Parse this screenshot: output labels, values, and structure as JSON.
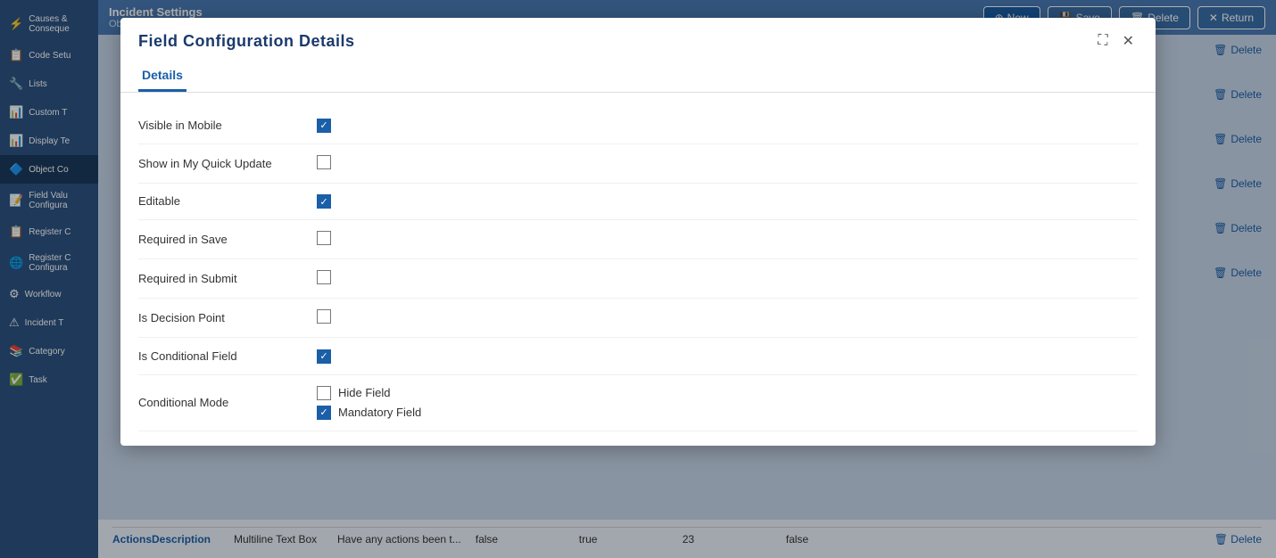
{
  "app": {
    "title": "Incident Settings",
    "subtitle": "Object Configuration Details"
  },
  "topbar": {
    "new_label": "New",
    "save_label": "Save",
    "delete_label": "Delete",
    "return_label": "Return"
  },
  "sidebar": {
    "items": [
      {
        "label": "Causes & Conseque",
        "icon": "⚡"
      },
      {
        "label": "Code Setu",
        "icon": "📋"
      },
      {
        "label": "Lists",
        "icon": "🔧"
      },
      {
        "label": "Custom T",
        "icon": "📊"
      },
      {
        "label": "Display Te",
        "icon": "📊"
      },
      {
        "label": "Object Co",
        "icon": "🔷",
        "active": true
      },
      {
        "label": "Field Valu Configura",
        "icon": "📝"
      },
      {
        "label": "Register C",
        "icon": "📋"
      },
      {
        "label": "Register C Configura",
        "icon": "🌐"
      },
      {
        "label": "Workflow",
        "icon": "⚙"
      },
      {
        "label": "Incident T",
        "icon": "⚠"
      },
      {
        "label": "Category",
        "icon": "📚"
      },
      {
        "label": "Task",
        "icon": "✅"
      }
    ]
  },
  "delete_buttons": [
    "Delete",
    "Delete",
    "Delete",
    "Delete",
    "Delete",
    "Delete"
  ],
  "modal": {
    "title": "Field  Configuration  Details",
    "tabs": [
      {
        "label": "Details",
        "active": true
      }
    ],
    "close_icon": "✕",
    "expand_icon": "⛶",
    "form_rows": [
      {
        "label": "Visible in Mobile",
        "type": "checkbox",
        "checked": true
      },
      {
        "label": "Show in My Quick Update",
        "type": "checkbox",
        "checked": false
      },
      {
        "label": "Editable",
        "type": "checkbox",
        "checked": true
      },
      {
        "label": "Required in Save",
        "type": "checkbox",
        "checked": false
      },
      {
        "label": "Required in Submit",
        "type": "checkbox",
        "checked": false
      },
      {
        "label": "Is Decision Point",
        "type": "checkbox",
        "checked": false
      },
      {
        "label": "Is Conditional Field",
        "type": "checkbox",
        "checked": true
      },
      {
        "label": "Conditional Mode",
        "type": "conditional",
        "options": [
          {
            "label": "Hide Field",
            "checked": false
          },
          {
            "label": "Mandatory Field",
            "checked": true
          }
        ]
      }
    ]
  },
  "bottom_table": {
    "row": {
      "name": "ActionsDescription",
      "type": "Multiline Text Box",
      "description": "Have any actions been t...",
      "col4": "false",
      "col5": "true",
      "col6": "23",
      "col7": "false"
    },
    "delete_label": "Delete"
  }
}
